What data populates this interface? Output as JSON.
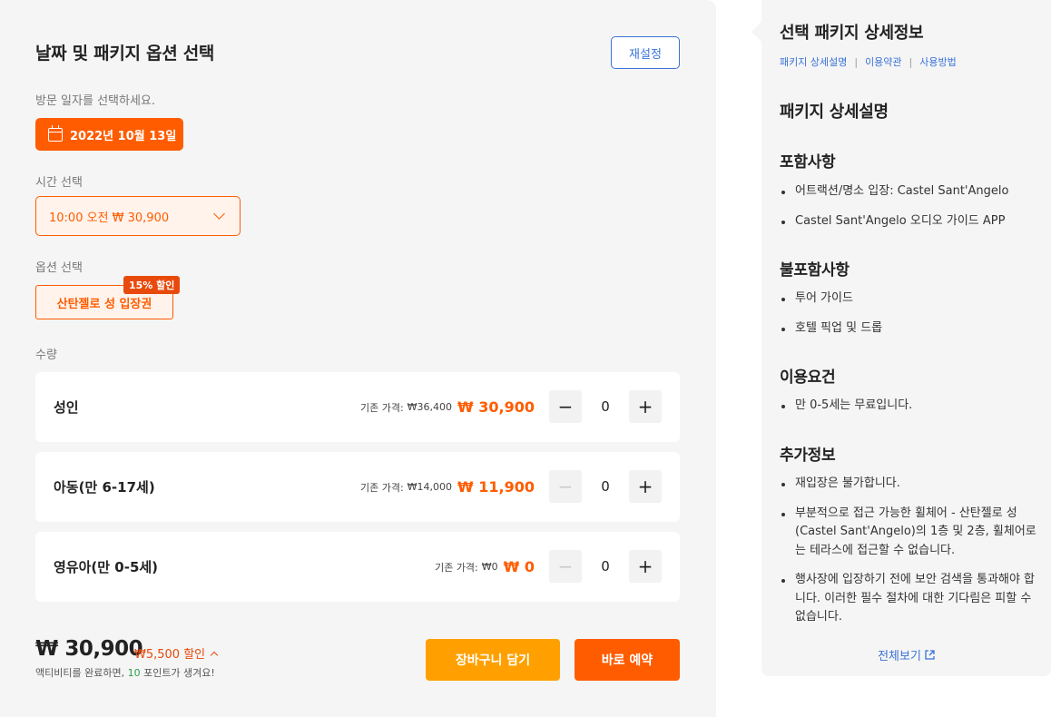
{
  "booking": {
    "title": "날짜 및 패키지 옵션 선택",
    "reset_label": "재설정",
    "date_prompt": "방문 일자를 선택하세요.",
    "selected_date": "2022년 10월 13일",
    "time_label": "시간 선택",
    "selected_time": "10:00 오전 ₩ 30,900",
    "option_label": "옵션 선택",
    "option_name": "산탄젤로 성 입장권",
    "option_discount": "15% 할인",
    "quantity_label": "수량",
    "price_prefix": "기존 가격:",
    "rows": [
      {
        "name": "성인",
        "base_price": "₩36,400",
        "sale_price": "₩ 30,900",
        "qty": "0",
        "minus": "−",
        "plus": "+"
      },
      {
        "name": "아동(만 6-17세)",
        "base_price": "₩14,000",
        "sale_price": "₩ 11,900",
        "qty": "0",
        "minus": "−",
        "plus": "+"
      },
      {
        "name": "영유아(만 0-5세)",
        "base_price": "₩0",
        "sale_price": "₩ 0",
        "qty": "0",
        "minus": "−",
        "plus": "+"
      }
    ],
    "total": "₩ 30,900",
    "total_discount": "₩5,500 할인",
    "points_before": "액티비티를 완료하면, ",
    "points_value": "10",
    "points_after": " 포인트가 생겨요!",
    "cart_label": "장바구니 담기",
    "book_label": "바로 예약"
  },
  "details": {
    "title": "선택 패키지 상세정보",
    "tabs": [
      "패키지 상세설명",
      "이용약관",
      "사용방법"
    ],
    "description_heading": "패키지 상세설명",
    "sections": [
      {
        "heading": "포함사항",
        "items": [
          "어트랙션/명소 입장: Castel Sant'Angelo",
          "Castel Sant'Angelo 오디오 가이드 APP"
        ]
      },
      {
        "heading": "불포함사항",
        "items": [
          "투어 가이드",
          "호텔 픽업 및 드롭"
        ]
      },
      {
        "heading": "이용요건",
        "items": [
          "만 0-5세는 무료입니다."
        ]
      },
      {
        "heading": "추가정보",
        "items": [
          "재입장은 불가합니다.",
          "부분적으로 접근 가능한 휠체어 - 산탄젤로 성(Castel Sant'Angelo)의 1층 및 2층, 휠체어로는 테라스에 접근할 수 없습니다.",
          "행사장에 입장하기 전에 보안 검색을 통과해야 합니다. 이러한 필수 절차에 대한 기다림은 피할 수 없습니다."
        ]
      }
    ],
    "view_all_label": "전체보기"
  },
  "icons": {
    "date": "calendar-icon",
    "time_dropdown": "chevron-down-icon",
    "discount_toggle": "chevron-up-icon",
    "view_all": "external-link-icon"
  },
  "colors": {
    "primary": "#ff5c00",
    "cart": "#ffa000",
    "link": "#3a72d8",
    "points": "#2a9d4a",
    "panel": "#f5f5f5"
  }
}
